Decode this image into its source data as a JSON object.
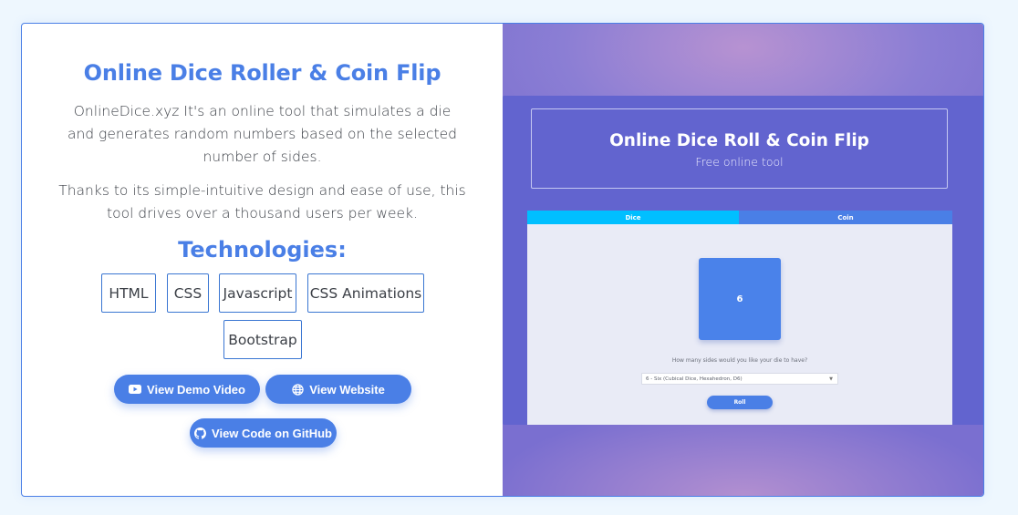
{
  "project": {
    "title": "Online Dice Roller & Coin Flip",
    "description_1": "OnlineDice.xyz It's an online tool that simulates a die and generates random numbers based on the selected number of sides.",
    "description_2": "Thanks to its simple-intuitive design and ease of use, this tool drives over a thousand users per week.",
    "technologies_heading": "Technologies:",
    "technologies": [
      "HTML",
      "CSS",
      "Javascript",
      "CSS Animations",
      "Bootstrap"
    ],
    "buttons": {
      "demo_video": "View Demo Video",
      "website": "View Website",
      "github": "View Code on GitHub"
    }
  },
  "preview": {
    "hero_title": "Online Dice Roll & Coin Flip",
    "hero_subtitle": "Free online tool",
    "tabs": [
      "Dice",
      "Coin"
    ],
    "die_value": "6",
    "question": "How many sides would you like your die to have?",
    "select_value": "6 - Six (Cubical Dice, Hexahedron, D6)",
    "roll_label": "Roll"
  },
  "colors": {
    "accent": "#4a7fe6",
    "tab_active": "#00bfff",
    "preview_bg": "#6264cf"
  },
  "icons": {
    "demo_video": "youtube-icon",
    "website": "globe-icon",
    "github": "github-icon"
  }
}
